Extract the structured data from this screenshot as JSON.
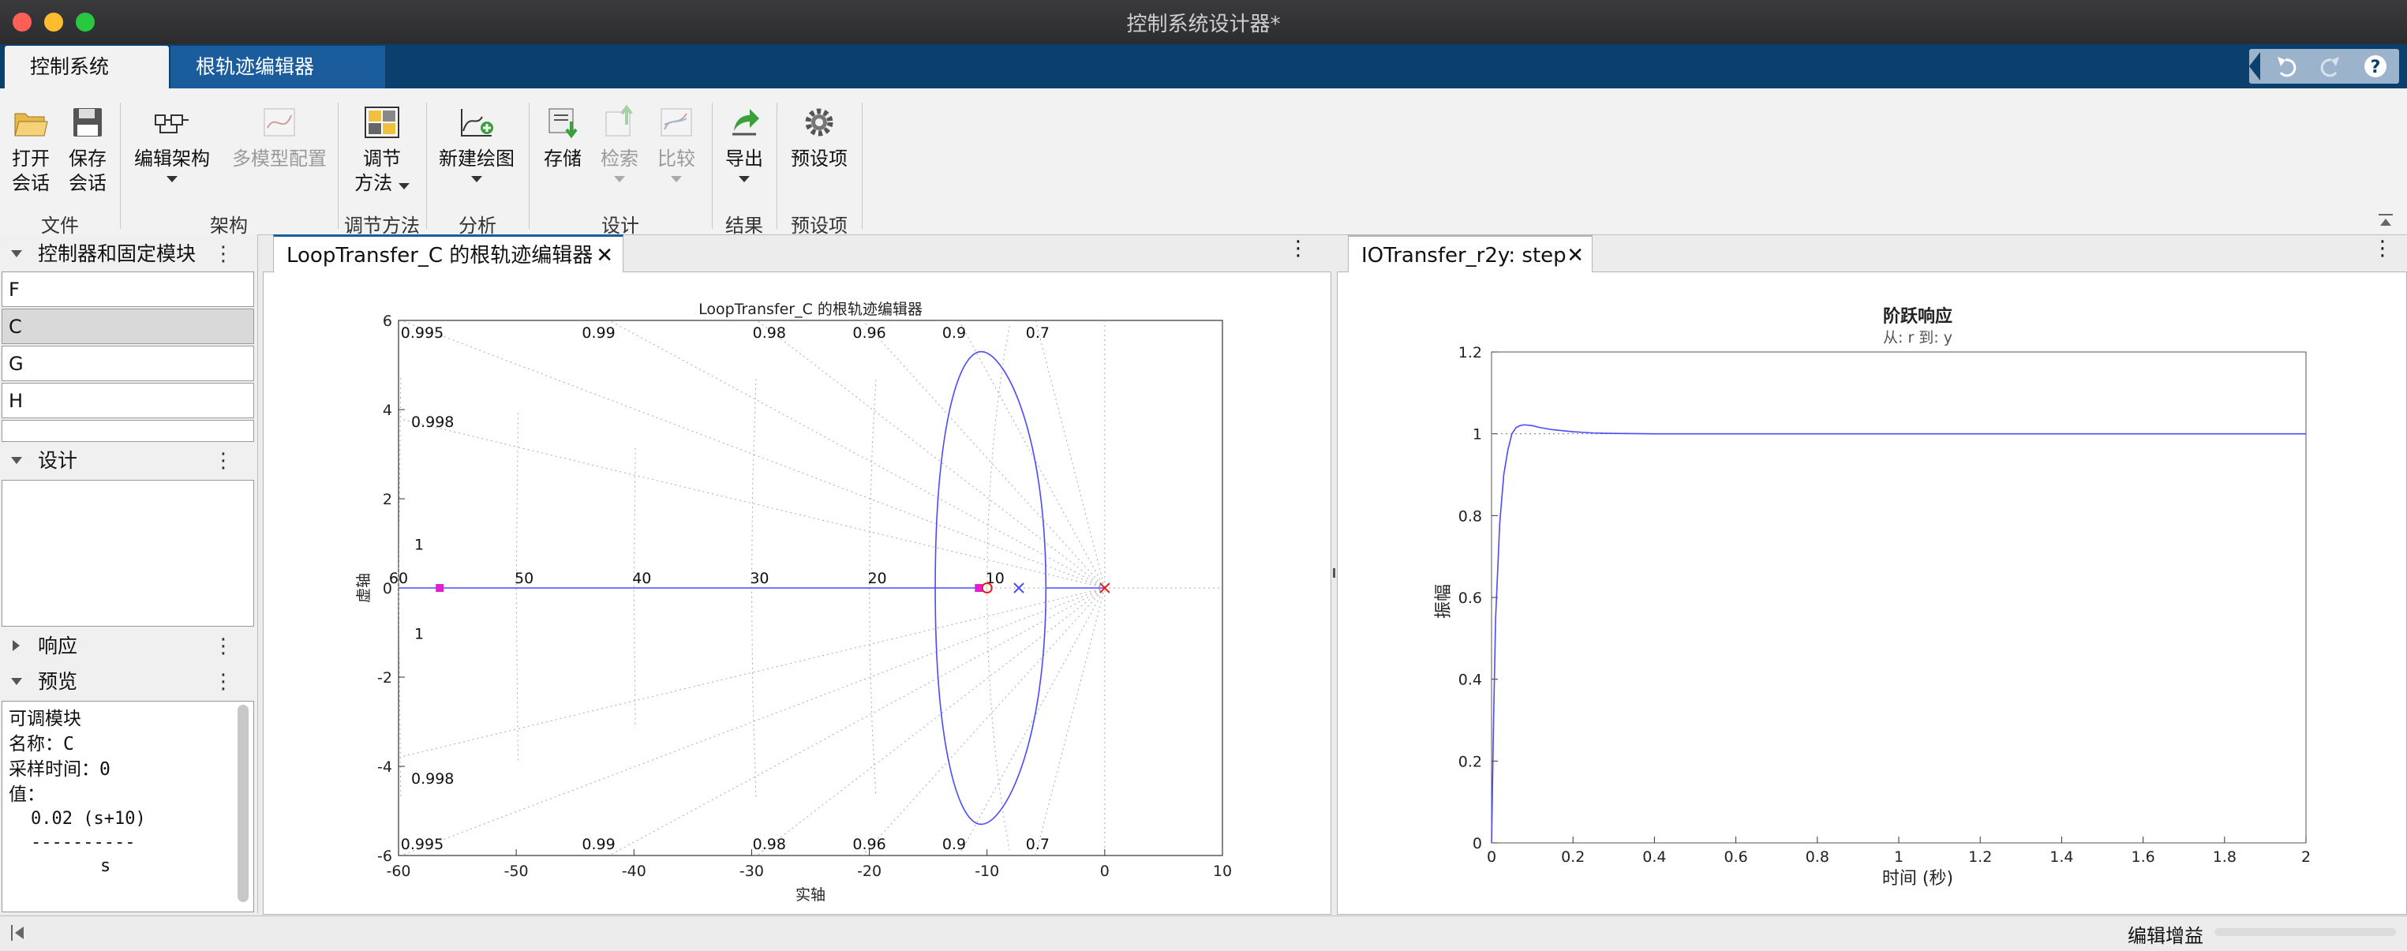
{
  "window": {
    "title": "控制系统设计器*"
  },
  "ribbon_tabs": [
    "控制系统",
    "根轨迹编辑器"
  ],
  "toolstrip": {
    "open": [
      "打开",
      "会话"
    ],
    "save": [
      "保存",
      "会话"
    ],
    "edit_arch": "编辑架构",
    "multi_model": "多模型配置",
    "tuning": [
      "调节",
      "方法"
    ],
    "new_plot": "新建绘图",
    "store": "存储",
    "retrieve": "检索",
    "compare": "比较",
    "export": "导出",
    "preferences": "预设项",
    "groups": [
      "文件",
      "架构",
      "调节方法",
      "分析",
      "设计",
      "结果",
      "预设项"
    ]
  },
  "left_panel": {
    "blocks_header": "控制器和固定模块",
    "blocks": [
      "F",
      "C",
      "G",
      "H"
    ],
    "selected_block": "C",
    "design_header": "设计",
    "response_header": "响应",
    "preview_header": "预览",
    "preview": {
      "title": "可调模块",
      "name_label": "名称：",
      "name_value": "C",
      "sample_label": "采样时间：",
      "sample_value": "0",
      "value_label": "值：",
      "numerator": "0.02 (s+10)",
      "fraction_bar": "----------",
      "denominator": "s"
    }
  },
  "doc_tabs": {
    "left": "LoopTransfer_C 的根轨迹编辑器",
    "right": "IOTransfer_r2y: step"
  },
  "status_bar": {
    "label": "编辑增益"
  },
  "colors": {
    "ribbon": "#0a3f6e",
    "locus": "#4a4aff",
    "pole_zero": "#e020d0",
    "closed_loop": "#e02020"
  },
  "chart_data": [
    {
      "type": "line",
      "title": "LoopTransfer_C 的根轨迹编辑器",
      "xlabel": "实轴",
      "ylabel": "虚轴",
      "xlim": [
        -60,
        10
      ],
      "ylim": [
        -6,
        6
      ],
      "xticks": [
        -60,
        -50,
        -40,
        -30,
        -20,
        -10,
        0,
        10
      ],
      "yticks": [
        -6,
        -4,
        -2,
        0,
        2,
        4,
        6
      ],
      "damping_labels_top": [
        "0.995",
        "0.99",
        "0.98",
        "0.96",
        "0.9",
        "0.7"
      ],
      "damping_labels_side": [
        "0.998",
        "1"
      ],
      "wn_labels": [
        "60",
        "50",
        "40",
        "30",
        "20",
        "10"
      ],
      "grid": true,
      "series": [
        {
          "values": [
            [
              -60,
              0
            ],
            [
              -10.5,
              0
            ]
          ]
        },
        {
          "values": [
            [
              -10.5,
              0
            ],
            [
              -14.4,
              0
            ],
            [
              -12.8,
              2.4
            ],
            [
              -10.5,
              5.3
            ],
            [
              -8.2,
              2.4
            ],
            [
              -5,
              0
            ],
            [
              -8.2,
              -2.4
            ],
            [
              -10.5,
              -5.3
            ],
            [
              -12.8,
              -2.4
            ],
            [
              -14.4,
              0
            ]
          ]
        },
        {
          "values": [
            [
              -5,
              0
            ],
            [
              0,
              0
            ]
          ]
        }
      ],
      "markers": [
        {
          "symbol": "square",
          "x": -56.5,
          "y": 0
        },
        {
          "symbol": "square",
          "x": -10.7,
          "y": 0
        },
        {
          "symbol": "circle",
          "x": -10,
          "y": 0
        },
        {
          "symbol": "x",
          "x": -7.3,
          "y": 0
        },
        {
          "symbol": "x",
          "x": 0,
          "y": 0
        }
      ]
    },
    {
      "type": "line",
      "title": "阶跃响应",
      "subtitle": "从: r  到: y",
      "xlabel": "时间 (秒)",
      "ylabel": "振幅",
      "xlim": [
        0,
        2
      ],
      "ylim": [
        0,
        1.2
      ],
      "xticks": [
        "0",
        "0.2",
        "0.4",
        "0.6",
        "0.8",
        "1",
        "1.2",
        "1.4",
        "1.6",
        "1.8",
        "2"
      ],
      "yticks": [
        "0",
        "0.2",
        "0.4",
        "0.6",
        "0.8",
        "1",
        "1.2"
      ],
      "reference": 1,
      "series": [
        {
          "x": [
            0,
            0.005,
            0.01,
            0.02,
            0.03,
            0.04,
            0.05,
            0.06,
            0.07,
            0.08,
            0.1,
            0.12,
            0.15,
            0.2,
            0.25,
            0.3,
            0.4,
            0.5,
            0.7,
            1.0,
            1.5,
            2.0
          ],
          "y": [
            0,
            0.3,
            0.55,
            0.78,
            0.9,
            0.96,
            1.0,
            1.015,
            1.02,
            1.022,
            1.02,
            1.015,
            1.01,
            1.005,
            1.002,
            1.001,
            1.0,
            1.0,
            1.0,
            1.0,
            1.0,
            1.0
          ]
        }
      ]
    }
  ]
}
